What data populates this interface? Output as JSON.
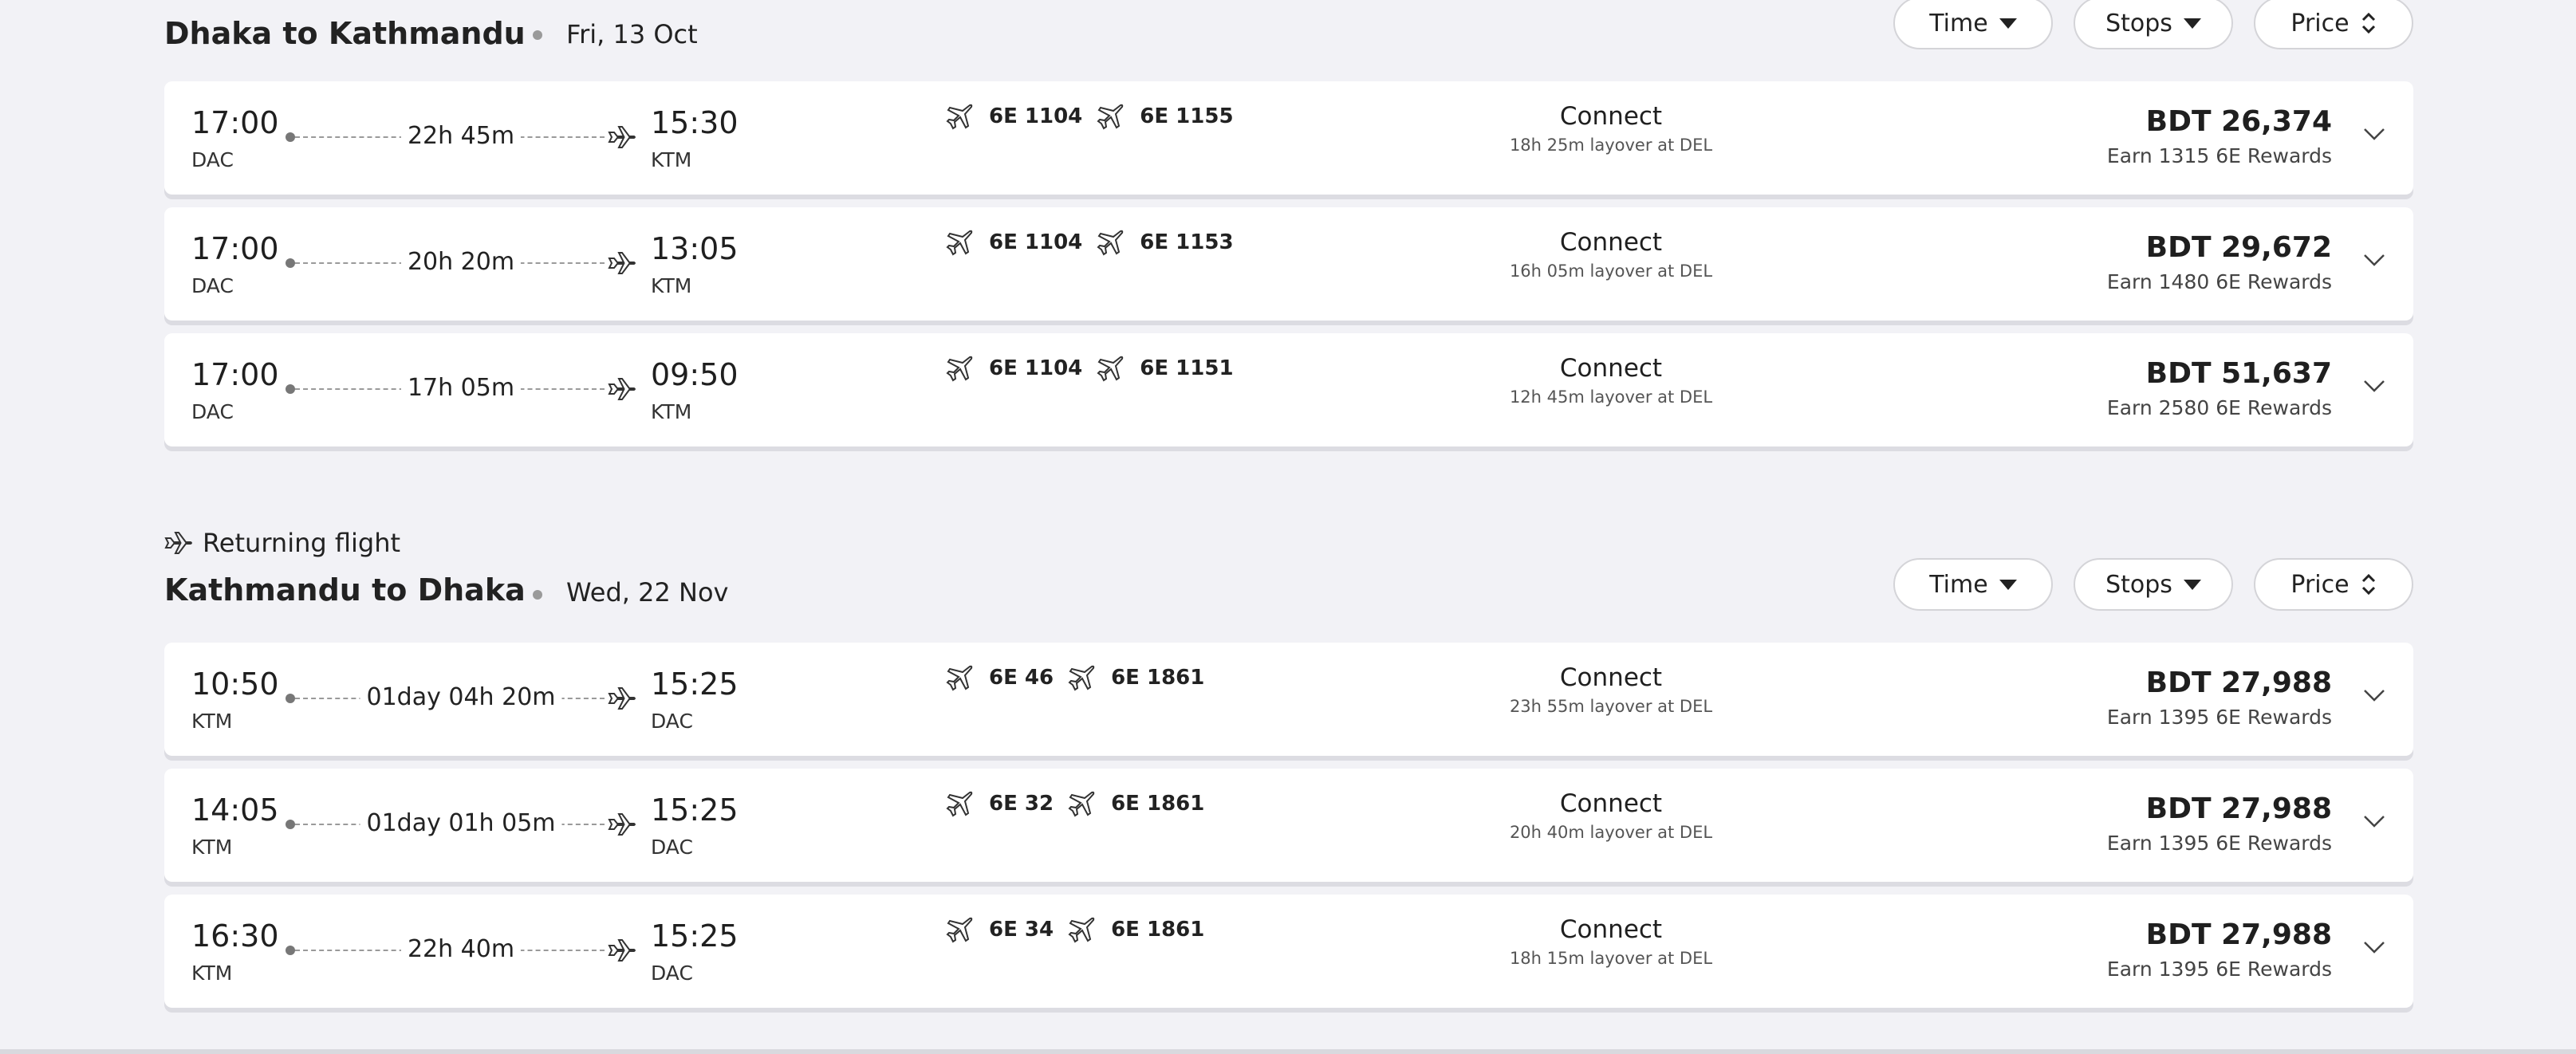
{
  "outbound": {
    "route": "Dhaka to Kathmandu",
    "date": "Fri, 13 Oct",
    "filters": {
      "time": "Time",
      "stops": "Stops",
      "price": "Price"
    },
    "flights": [
      {
        "dep_time": "17:00",
        "dep_code": "DAC",
        "duration": "22h 45m",
        "arr_time": "15:30",
        "arr_code": "KTM",
        "flight1": "6E 1104",
        "flight2": "6E 1155",
        "stop_label": "Connect",
        "layover": "18h 25m layover at DEL",
        "price": "BDT 26,374",
        "rewards": "Earn 1315 6E Rewards"
      },
      {
        "dep_time": "17:00",
        "dep_code": "DAC",
        "duration": "20h 20m",
        "arr_time": "13:05",
        "arr_code": "KTM",
        "flight1": "6E 1104",
        "flight2": "6E 1153",
        "stop_label": "Connect",
        "layover": "16h 05m layover at DEL",
        "price": "BDT 29,672",
        "rewards": "Earn 1480 6E Rewards"
      },
      {
        "dep_time": "17:00",
        "dep_code": "DAC",
        "duration": "17h 05m",
        "arr_time": "09:50",
        "arr_code": "KTM",
        "flight1": "6E 1104",
        "flight2": "6E 1151",
        "stop_label": "Connect",
        "layover": "12h 45m layover at DEL",
        "price": "BDT 51,637",
        "rewards": "Earn 2580 6E Rewards"
      }
    ]
  },
  "returning": {
    "label": "Returning flight",
    "route": "Kathmandu to Dhaka",
    "date": "Wed, 22 Nov",
    "filters": {
      "time": "Time",
      "stops": "Stops",
      "price": "Price"
    },
    "flights": [
      {
        "dep_time": "10:50",
        "dep_code": "KTM",
        "duration": "01day 04h 20m",
        "arr_time": "15:25",
        "arr_code": "DAC",
        "flight1": "6E 46",
        "flight2": "6E 1861",
        "stop_label": "Connect",
        "layover": "23h 55m layover at DEL",
        "price": "BDT 27,988",
        "rewards": "Earn 1395 6E Rewards"
      },
      {
        "dep_time": "14:05",
        "dep_code": "KTM",
        "duration": "01day 01h 05m",
        "arr_time": "15:25",
        "arr_code": "DAC",
        "flight1": "6E 32",
        "flight2": "6E 1861",
        "stop_label": "Connect",
        "layover": "20h 40m layover at DEL",
        "price": "BDT 27,988",
        "rewards": "Earn 1395 6E Rewards"
      },
      {
        "dep_time": "16:30",
        "dep_code": "KTM",
        "duration": "22h 40m",
        "arr_time": "15:25",
        "arr_code": "DAC",
        "flight1": "6E 34",
        "flight2": "6E 1861",
        "stop_label": "Connect",
        "layover": "18h 15m layover at DEL",
        "price": "BDT 27,988",
        "rewards": "Earn 1395 6E Rewards"
      }
    ]
  },
  "icons": {
    "flight": "airplane-icon",
    "arrival": "plane-arrival-icon",
    "expand": "chevron-down-icon",
    "sort": "sort-updown-icon",
    "dropdown": "caret-down-icon"
  }
}
